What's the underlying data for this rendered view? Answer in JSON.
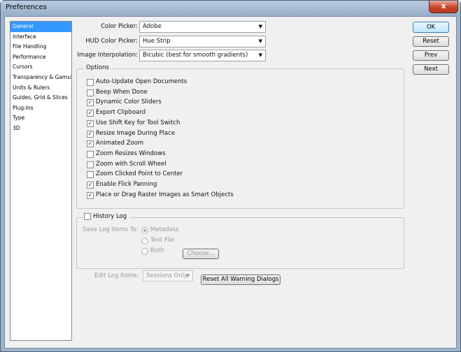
{
  "window": {
    "title": "Preferences",
    "close_symbol": "x"
  },
  "sidebar": {
    "items": [
      {
        "label": "General",
        "selected": true
      },
      {
        "label": "Interface"
      },
      {
        "label": "File Handling"
      },
      {
        "label": "Performance"
      },
      {
        "label": "Cursors"
      },
      {
        "label": "Transparency & Gamut"
      },
      {
        "label": "Units & Rulers"
      },
      {
        "label": "Guides, Grid & Slices"
      },
      {
        "label": "Plug-Ins"
      },
      {
        "label": "Type"
      },
      {
        "label": "3D"
      }
    ]
  },
  "fields": {
    "color_picker": {
      "label": "Color Picker:",
      "value": "Adobe"
    },
    "hud_color_picker": {
      "label": "HUD Color Picker:",
      "value": "Hue Strip"
    },
    "image_interpolation": {
      "label": "Image Interpolation:",
      "value": "Bicubic (best for smooth gradients)"
    }
  },
  "options": {
    "legend": "Options",
    "items": [
      {
        "label": "Auto-Update Open Documents",
        "checked": false
      },
      {
        "label": "Beep When Done",
        "checked": false
      },
      {
        "label": "Dynamic Color Sliders",
        "checked": true
      },
      {
        "label": "Export Clipboard",
        "checked": true
      },
      {
        "label": "Use Shift Key for Tool Switch",
        "checked": true
      },
      {
        "label": "Resize Image During Place",
        "checked": true
      },
      {
        "label": "Animated Zoom",
        "checked": true
      },
      {
        "label": "Zoom Resizes Windows",
        "checked": false
      },
      {
        "label": "Zoom with Scroll Wheel",
        "checked": false
      },
      {
        "label": "Zoom Clicked Point to Center",
        "checked": false
      },
      {
        "label": "Enable Flick Panning",
        "checked": true
      },
      {
        "label": "Place or Drag Raster Images as Smart Objects",
        "checked": true
      }
    ]
  },
  "history": {
    "legend": "History Log",
    "checked": false,
    "save_label": "Save Log Items To:",
    "radios": [
      {
        "label": "Metadata",
        "selected": true
      },
      {
        "label": "Text File",
        "selected": false
      },
      {
        "label": "Both",
        "selected": false
      }
    ],
    "choose_label": "Choose...",
    "edit_label": "Edit Log Items:",
    "edit_value": "Sessions Only"
  },
  "buttons": {
    "ok": "OK",
    "reset": "Reset",
    "prev": "Prev",
    "next": "Next",
    "reset_warnings": "Reset All Warning Dialogs"
  },
  "check_glyph": "✓",
  "arrow_glyph": "▼"
}
